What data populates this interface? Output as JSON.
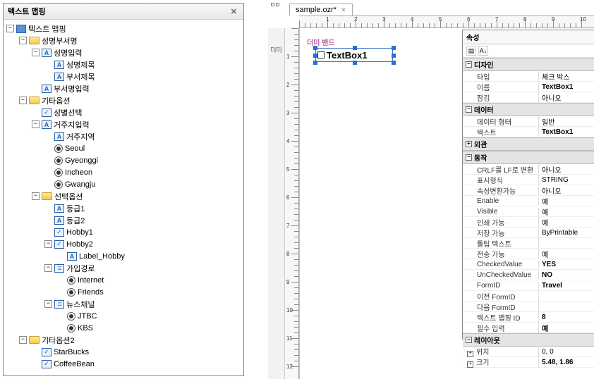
{
  "leftPanel": {
    "title": "텍스트 맵핑"
  },
  "tree": [
    {
      "d": 0,
      "t": "-",
      "i": "root",
      "l": "텍스트 맵핑"
    },
    {
      "d": 1,
      "t": "-",
      "i": "folder",
      "l": "성명부서명"
    },
    {
      "d": 2,
      "t": "-",
      "i": "a",
      "l": "성명입력"
    },
    {
      "d": 3,
      "t": "",
      "i": "a",
      "l": "성명제목"
    },
    {
      "d": 3,
      "t": "",
      "i": "a",
      "l": "부서제목"
    },
    {
      "d": 2,
      "t": "",
      "i": "a",
      "l": "부서명입력"
    },
    {
      "d": 1,
      "t": "-",
      "i": "folder",
      "l": "기타옵션"
    },
    {
      "d": 2,
      "t": "",
      "i": "check",
      "l": "성별선택"
    },
    {
      "d": 2,
      "t": "-",
      "i": "a",
      "l": "거주지입력"
    },
    {
      "d": 3,
      "t": "",
      "i": "a",
      "l": "거주지역"
    },
    {
      "d": 3,
      "t": "",
      "i": "radio",
      "l": "Seoul"
    },
    {
      "d": 3,
      "t": "",
      "i": "radio",
      "l": "Gyeonggi"
    },
    {
      "d": 3,
      "t": "",
      "i": "radio",
      "l": "Incheon"
    },
    {
      "d": 3,
      "t": "",
      "i": "radio",
      "l": "Gwangju"
    },
    {
      "d": 2,
      "t": "-",
      "i": "folder",
      "l": "선택옵션"
    },
    {
      "d": 3,
      "t": "",
      "i": "a",
      "l": "등급1"
    },
    {
      "d": 3,
      "t": "",
      "i": "a",
      "l": "등급2"
    },
    {
      "d": 3,
      "t": "",
      "i": "check",
      "l": "Hobby1"
    },
    {
      "d": 3,
      "t": "-",
      "i": "check",
      "l": "Hobby2"
    },
    {
      "d": 4,
      "t": "",
      "i": "a",
      "l": "Label_Hobby"
    },
    {
      "d": 3,
      "t": "-",
      "i": "list",
      "l": "가입경로"
    },
    {
      "d": 4,
      "t": "",
      "i": "radio",
      "l": "Internet"
    },
    {
      "d": 4,
      "t": "",
      "i": "radio",
      "l": "Friends"
    },
    {
      "d": 3,
      "t": "-",
      "i": "list",
      "l": "뉴스채널"
    },
    {
      "d": 4,
      "t": "",
      "i": "radio",
      "l": "JTBC"
    },
    {
      "d": 4,
      "t": "",
      "i": "radio",
      "l": "KBS"
    },
    {
      "d": 1,
      "t": "-",
      "i": "folder",
      "l": "기타옵션2"
    },
    {
      "d": 2,
      "t": "",
      "i": "check",
      "l": "StarBucks"
    },
    {
      "d": 2,
      "t": "",
      "i": "check",
      "l": "CoffeeBean"
    }
  ],
  "tab": {
    "name": "sample.ozr*"
  },
  "dummyLabel": "더미",
  "bandLabel": "더미 밴드",
  "textbox": {
    "label": "TextBox1"
  },
  "props": {
    "title": "속성",
    "sections": {
      "design": "디자인",
      "data": "데이터",
      "appearance": "외관",
      "behavior": "동작",
      "layout": "레이아웃"
    },
    "rows": {
      "type": {
        "k": "타입",
        "v": "체크 박스"
      },
      "name": {
        "k": "이름",
        "v": "TextBox1",
        "b": true
      },
      "lock": {
        "k": "잠김",
        "v": "아니오"
      },
      "dtype": {
        "k": "데이터 형태",
        "v": "일반"
      },
      "text": {
        "k": "텍스트",
        "v": "TextBox1",
        "b": true
      },
      "crlf": {
        "k": "CRLF를 LF로 변환",
        "v": "아니오"
      },
      "fmt": {
        "k": "표시형식",
        "v": "STRING"
      },
      "attr": {
        "k": "속성변환가능",
        "v": "아니오"
      },
      "enable": {
        "k": "Enable",
        "v": "예"
      },
      "visible": {
        "k": "Visible",
        "v": "예"
      },
      "print": {
        "k": "인쇄 가능",
        "v": "예"
      },
      "save": {
        "k": "저장 가능",
        "v": "ByPrintable"
      },
      "tooltip": {
        "k": "툴팁 텍스트",
        "v": ""
      },
      "send": {
        "k": "전송 가능",
        "v": "예"
      },
      "cval": {
        "k": "CheckedValue",
        "v": "YES",
        "b": true
      },
      "uval": {
        "k": "UnCheckedValue",
        "v": "NO",
        "b": true
      },
      "formid": {
        "k": "FormID",
        "v": "Travel",
        "b": true
      },
      "prevf": {
        "k": "이전 FormID",
        "v": ""
      },
      "nextf": {
        "k": "다음 FormID",
        "v": ""
      },
      "mapid": {
        "k": "텍스트 맵핑 ID",
        "v": "8",
        "b": true
      },
      "req": {
        "k": "필수 입력",
        "v": "예",
        "b": true
      },
      "pos": {
        "k": "위치",
        "v": "0, 0"
      },
      "size": {
        "k": "크기",
        "v": "5.48, 1.86",
        "b": true
      }
    }
  }
}
